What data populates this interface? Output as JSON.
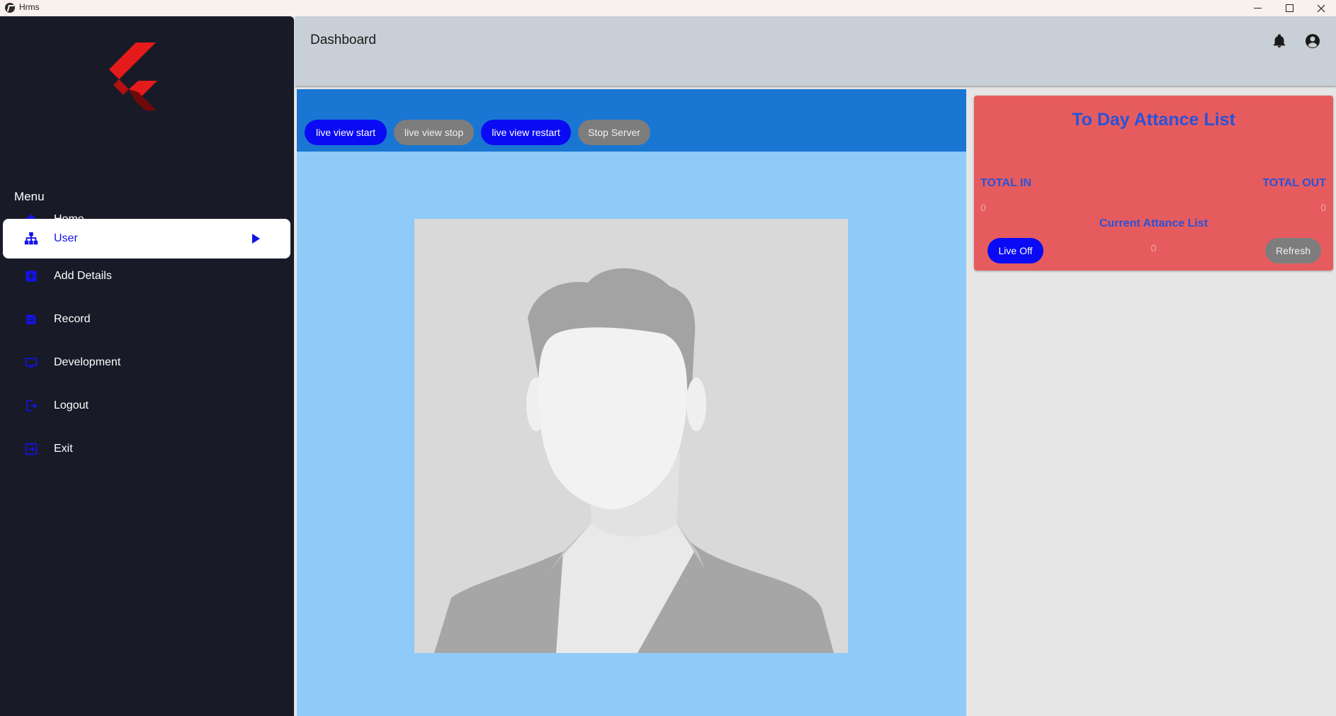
{
  "window": {
    "title": "Hrms"
  },
  "sidebar": {
    "menu_heading": "Menu",
    "items": [
      {
        "label": "Home",
        "icon": "home-icon",
        "active": false
      },
      {
        "label": "User",
        "icon": "sitemap-icon",
        "active": true
      },
      {
        "label": "Add Details",
        "icon": "add-box-icon",
        "active": false
      },
      {
        "label": "Record",
        "icon": "record-icon",
        "active": false
      },
      {
        "label": "Development",
        "icon": "monitor-icon",
        "active": false
      },
      {
        "label": "Logout",
        "icon": "logout-icon",
        "active": false
      },
      {
        "label": "Exit",
        "icon": "exit-icon",
        "active": false
      }
    ]
  },
  "header": {
    "title": "Dashboard"
  },
  "live_view": {
    "buttons": [
      {
        "label": "live view start",
        "style": "blue"
      },
      {
        "label": "live view stop",
        "style": "grey"
      },
      {
        "label": "live view restart",
        "style": "blue"
      },
      {
        "label": "Stop Server",
        "style": "grey"
      }
    ]
  },
  "attendance": {
    "title": "To Day Attance List",
    "total_in_label": "TOTAL IN",
    "total_out_label": "TOTAL OUT",
    "total_in_value": "0",
    "total_out_value": "0",
    "current_label": "Current Attance List",
    "current_value": "0",
    "live_button": "Live Off",
    "refresh_button": "Refresh"
  },
  "colors": {
    "sidebar_bg": "#191a27",
    "accent_blue": "#0a0af5",
    "toolbar_blue": "#1976d2",
    "panel_light_blue": "#90caf9",
    "card_red": "#e65c5e",
    "card_text_blue": "#2a52d8"
  }
}
